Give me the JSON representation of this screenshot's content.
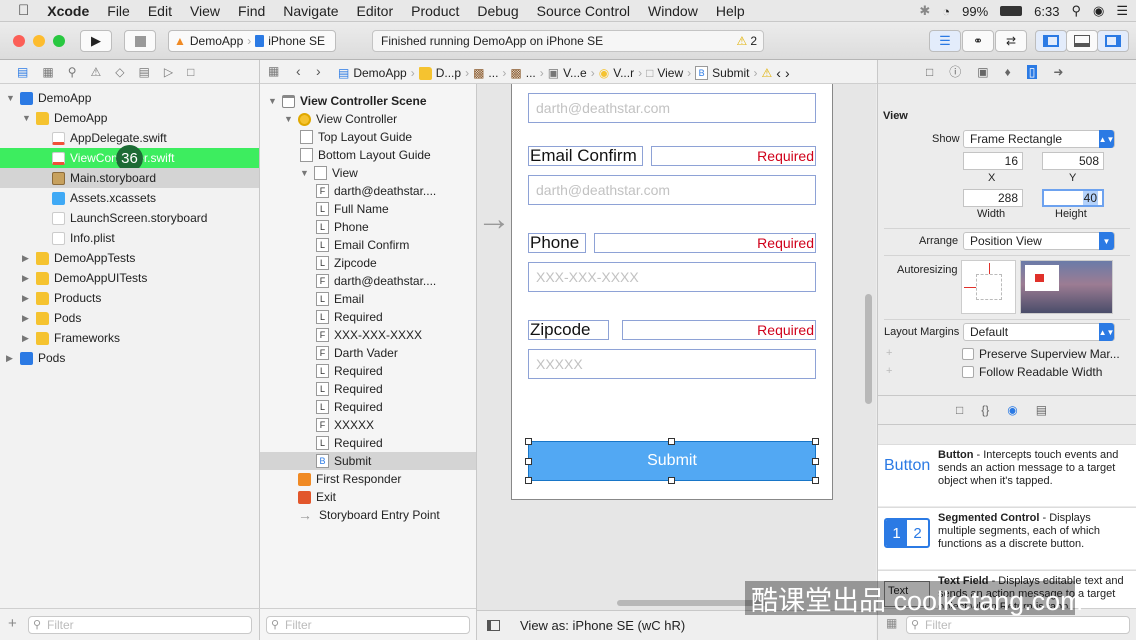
{
  "menubar": {
    "app": "Xcode",
    "items": [
      "File",
      "Edit",
      "View",
      "Find",
      "Navigate",
      "Editor",
      "Product",
      "Debug",
      "Source Control",
      "Window",
      "Help"
    ],
    "battery": "99%",
    "time": "6:33"
  },
  "toolbar": {
    "scheme": "DemoApp",
    "device": "iPhone SE",
    "status": "Finished running DemoApp on iPhone SE",
    "warnings": "2"
  },
  "navigator": {
    "tree": [
      {
        "label": "DemoApp",
        "indent": 0,
        "kind": "project",
        "open": true
      },
      {
        "label": "DemoApp",
        "indent": 1,
        "kind": "folder",
        "open": true
      },
      {
        "label": "AppDelegate.swift",
        "indent": 2,
        "kind": "swift"
      },
      {
        "label": "ViewController.swift",
        "indent": 2,
        "kind": "swift"
      },
      {
        "label": "Main.storyboard",
        "indent": 2,
        "kind": "storyboard"
      },
      {
        "label": "Assets.xcassets",
        "indent": 2,
        "kind": "assets"
      },
      {
        "label": "LaunchScreen.storyboard",
        "indent": 2,
        "kind": "storyboard2"
      },
      {
        "label": "Info.plist",
        "indent": 2,
        "kind": "plist"
      },
      {
        "label": "DemoAppTests",
        "indent": 1,
        "kind": "folder"
      },
      {
        "label": "DemoAppUITests",
        "indent": 1,
        "kind": "folder"
      },
      {
        "label": "Products",
        "indent": 1,
        "kind": "folder"
      },
      {
        "label": "Pods",
        "indent": 1,
        "kind": "folder"
      },
      {
        "label": "Frameworks",
        "indent": 1,
        "kind": "folder"
      },
      {
        "label": "Pods",
        "indent": 0,
        "kind": "project"
      }
    ],
    "badge": "36",
    "filter_placeholder": "Filter"
  },
  "jumpbar": [
    "DemoApp",
    "D...p",
    "...",
    "...",
    "V...e",
    "V...r",
    "View",
    "Submit"
  ],
  "outline": {
    "items": [
      {
        "label": "View Controller Scene",
        "indent": 0,
        "icon": "scene",
        "bold": true
      },
      {
        "label": "View Controller",
        "indent": 1,
        "icon": "vc"
      },
      {
        "label": "Top Layout Guide",
        "indent": 2,
        "icon": "box"
      },
      {
        "label": "Bottom Layout Guide",
        "indent": 2,
        "icon": "box"
      },
      {
        "label": "View",
        "indent": 2,
        "icon": "view"
      },
      {
        "label": "darth@deathstar....",
        "indent": 3,
        "icon": "F"
      },
      {
        "label": "Full Name",
        "indent": 3,
        "icon": "L"
      },
      {
        "label": "Phone",
        "indent": 3,
        "icon": "L"
      },
      {
        "label": "Email Confirm",
        "indent": 3,
        "icon": "L"
      },
      {
        "label": "Zipcode",
        "indent": 3,
        "icon": "L"
      },
      {
        "label": "darth@deathstar....",
        "indent": 3,
        "icon": "F"
      },
      {
        "label": "Email",
        "indent": 3,
        "icon": "L"
      },
      {
        "label": "Required",
        "indent": 3,
        "icon": "L"
      },
      {
        "label": "XXX-XXX-XXXX",
        "indent": 3,
        "icon": "F"
      },
      {
        "label": "Darth Vader",
        "indent": 3,
        "icon": "F"
      },
      {
        "label": "Required",
        "indent": 3,
        "icon": "L"
      },
      {
        "label": "Required",
        "indent": 3,
        "icon": "L"
      },
      {
        "label": "Required",
        "indent": 3,
        "icon": "L"
      },
      {
        "label": "XXXXX",
        "indent": 3,
        "icon": "F"
      },
      {
        "label": "Required",
        "indent": 3,
        "icon": "L"
      },
      {
        "label": "Submit",
        "indent": 3,
        "icon": "B"
      },
      {
        "label": "First Responder",
        "indent": 1,
        "icon": "cube"
      },
      {
        "label": "Exit",
        "indent": 1,
        "icon": "exit"
      },
      {
        "label": "Storyboard Entry Point",
        "indent": 1,
        "icon": "arrow"
      }
    ],
    "filter_placeholder": "Filter"
  },
  "canvas": {
    "email_placeholder": "darth@deathstar.com",
    "email_confirm_label": "Email Confirm",
    "required": "Required",
    "email_confirm_placeholder": "darth@deathstar.com",
    "phone_label": "Phone",
    "phone_placeholder": "XXX-XXX-XXXX",
    "zipcode_label": "Zipcode",
    "zipcode_placeholder": "XXXXX",
    "submit": "Submit",
    "view_as": "View as: iPhone SE (wC hR)"
  },
  "inspector": {
    "section": "View",
    "show_label": "Show",
    "show_value": "Frame Rectangle",
    "x": "16",
    "y": "508",
    "x_label": "X",
    "y_label": "Y",
    "width": "288",
    "height": "40",
    "width_label": "Width",
    "height_label": "Height",
    "arrange_label": "Arrange",
    "arrange_value": "Position View",
    "autoresizing_label": "Autoresizing",
    "margins_label": "Layout Margins",
    "margins_value": "Default",
    "preserve": "Preserve Superview Mar...",
    "readable": "Follow Readable Width",
    "library": [
      {
        "title": "Button",
        "desc": " - Intercepts touch events and sends an action message to a target object when it's tapped.",
        "icon": "Button"
      },
      {
        "title": "Segmented Control",
        "desc": " - Displays multiple segments, each of which functions as a discrete button.",
        "icon": "1 2"
      },
      {
        "title": "Text Field",
        "desc": " - Displays editable text and sends an action message to a target object when Return is tapp...",
        "icon": "Text"
      }
    ],
    "filter_placeholder": "Filter"
  },
  "watermark": "酷课堂出品 coolketang.com"
}
